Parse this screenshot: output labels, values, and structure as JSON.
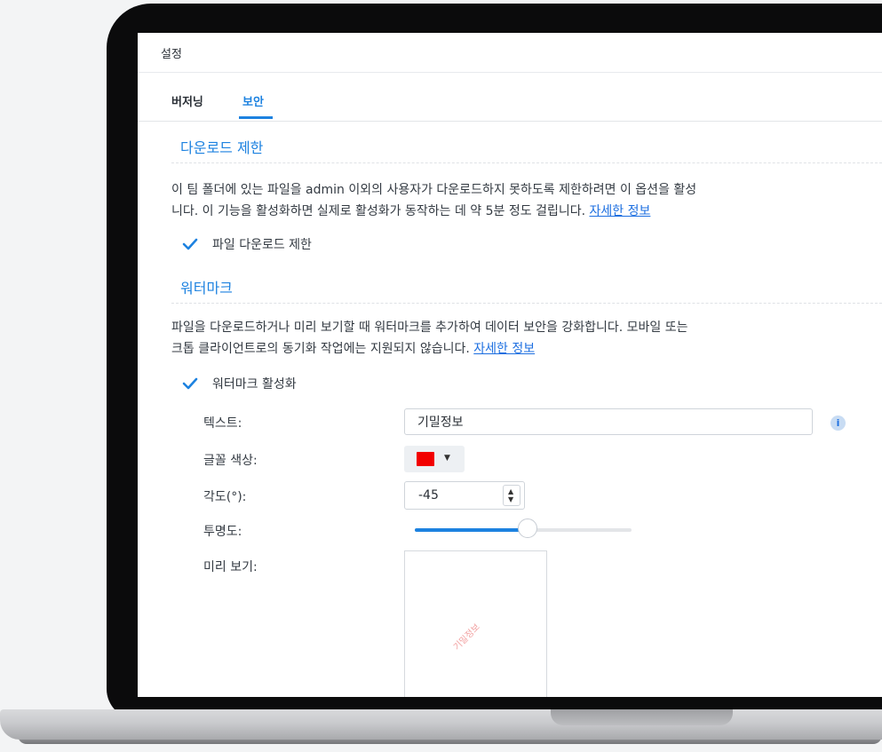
{
  "window": {
    "title": "설정"
  },
  "tabs": [
    {
      "label": "버저닝",
      "active": false
    },
    {
      "label": "보안",
      "active": true
    }
  ],
  "download_section": {
    "title": "다운로드 제한",
    "desc_line1": "이 팀 폴더에 있는 파일을 admin 이외의 사용자가 다운로드하지 못하도록 제한하려면 이 옵션을 활성",
    "desc_line2": "니다. 이 기능을 활성화하면 실제로 활성화가 동작하는 데 약 5분 정도 걸립니다. ",
    "link": "자세한 정보",
    "checkbox_label": "파일 다운로드 제한",
    "checked": true
  },
  "watermark_section": {
    "title": "워터마크",
    "desc_line1": "파일을 다운로드하거나 미리 보기할 때 워터마크를 추가하여 데이터 보안을 강화합니다. 모바일 또는",
    "desc_line2": "크톱 클라이언트로의 동기화 작업에는 지원되지 않습니다. ",
    "link": "자세한 정보",
    "checkbox_label": "워터마크 활성화",
    "checked": true,
    "fields": {
      "text_label": "텍스트:",
      "text_value": "기밀정보",
      "color_label": "글꼴 색상:",
      "color_value": "#f20000",
      "angle_label": "각도(°):",
      "angle_value": "-45",
      "opacity_label": "투명도:",
      "opacity_fraction": 0.52,
      "preview_label": "미리 보기:",
      "preview_text": "기밀정보"
    }
  },
  "icons": {
    "info": "info-icon",
    "check": "check-icon",
    "caret": "chevron-down-icon"
  },
  "accent_color": "#1d82e0"
}
